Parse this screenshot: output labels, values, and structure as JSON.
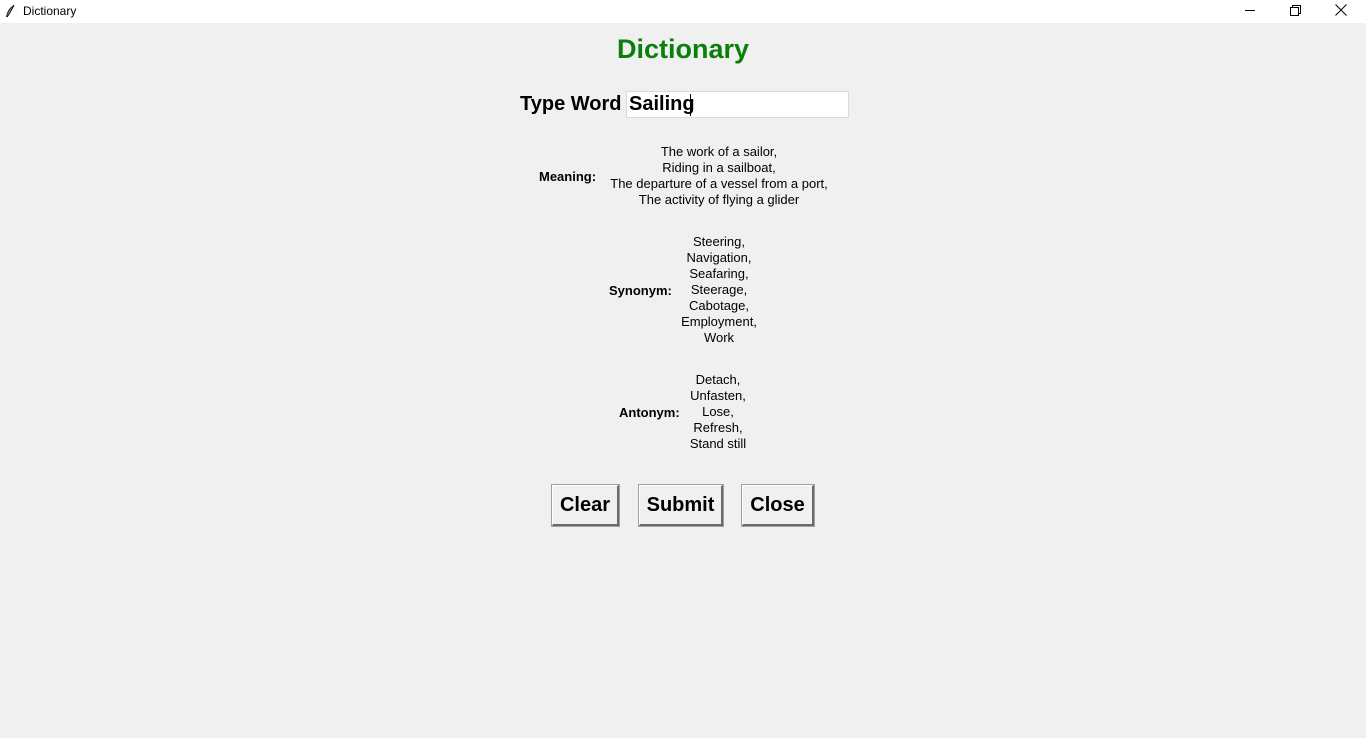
{
  "window": {
    "title": "Dictionary",
    "icons": {
      "app": "feather-icon",
      "minimize": "minimize-icon",
      "maximize": "restore-icon",
      "close": "close-icon"
    }
  },
  "main": {
    "heading": "Dictionary",
    "heading_color": "#0a800a",
    "type_word_label": "Type Word",
    "word_value": "Sailing",
    "meaning": {
      "label": "Meaning:",
      "lines": [
        "The work of a sailor,",
        "Riding in a sailboat,",
        "The departure of a vessel from a port,",
        "The activity of flying a glider"
      ]
    },
    "synonym": {
      "label": "Synonym:",
      "lines": [
        "Steering,",
        "Navigation,",
        "Seafaring,",
        "Steerage,",
        "Cabotage,",
        "Employment,",
        "Work"
      ]
    },
    "antonym": {
      "label": "Antonym:",
      "lines": [
        "Detach,",
        "Unfasten,",
        "Lose,",
        "Refresh,",
        "Stand still"
      ]
    },
    "buttons": {
      "clear": "Clear",
      "submit": "Submit",
      "close": "Close"
    }
  }
}
